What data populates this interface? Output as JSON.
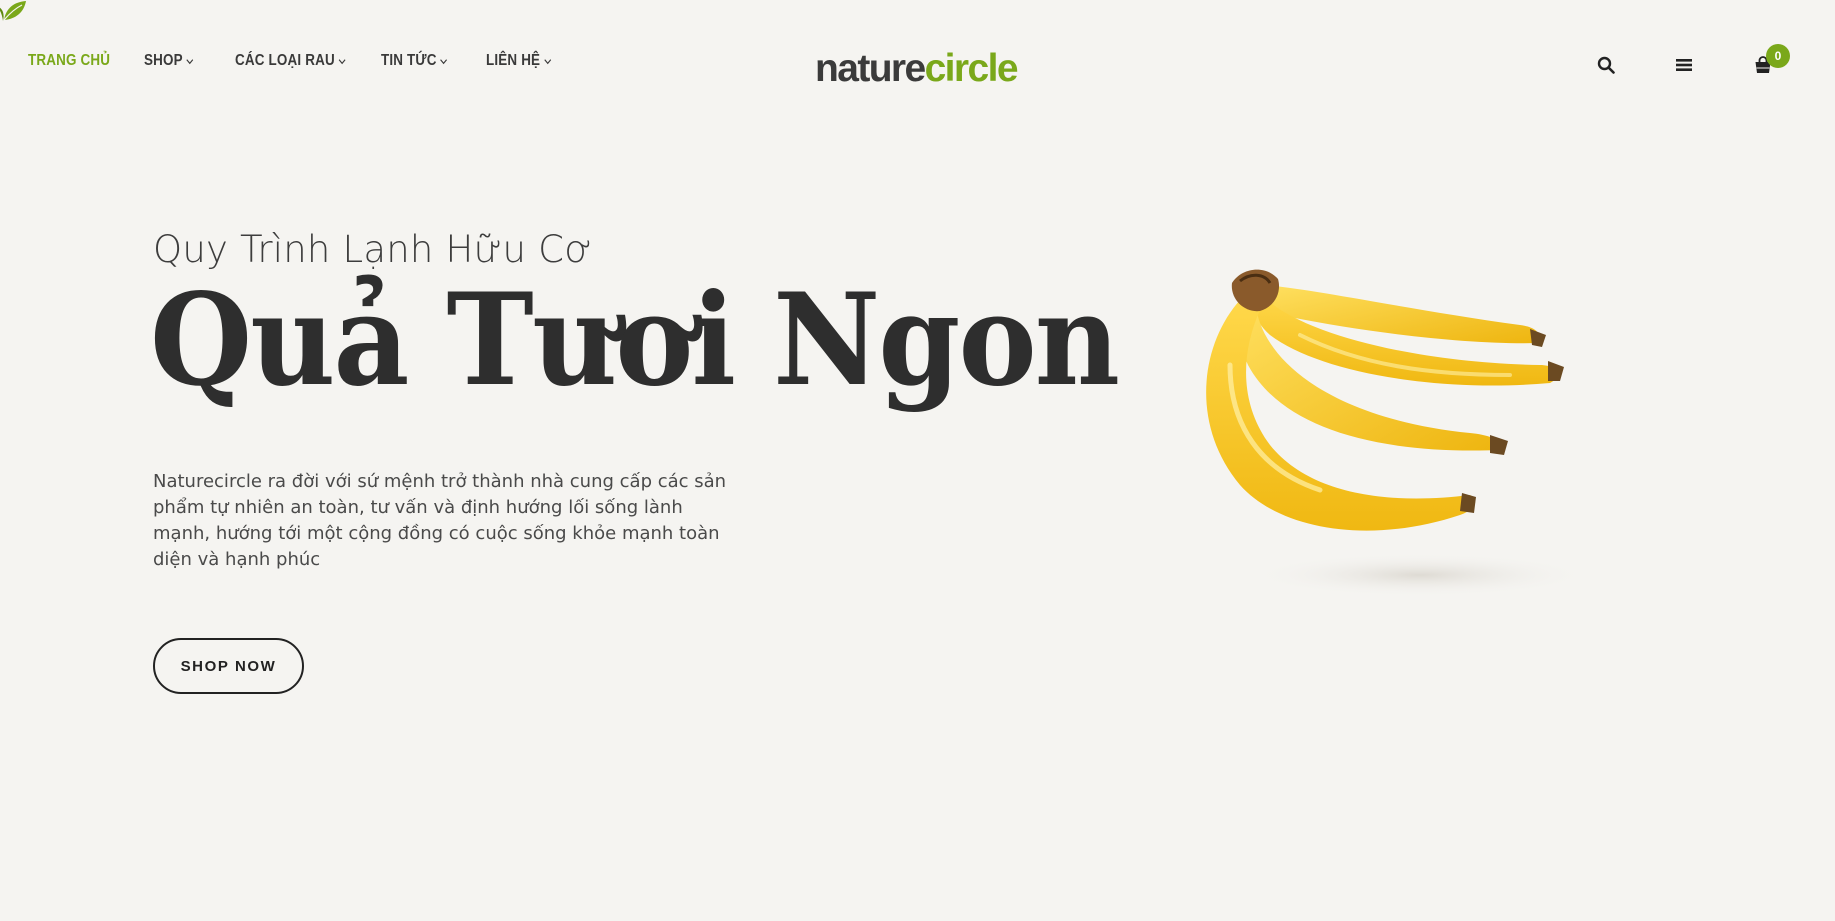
{
  "header": {
    "nav": [
      {
        "label": "TRANG CHỦ",
        "active": true,
        "has_dropdown": false
      },
      {
        "label": "SHOP",
        "active": false,
        "has_dropdown": true
      },
      {
        "label": "CÁC LOẠI RAU",
        "active": false,
        "has_dropdown": true
      },
      {
        "label": "TIN TỨC",
        "active": false,
        "has_dropdown": true
      },
      {
        "label": "LIÊN HỆ",
        "active": false,
        "has_dropdown": true
      }
    ],
    "logo": {
      "part1": "nature",
      "part2": "circle"
    },
    "icons": [
      "search-icon",
      "menu-icon",
      "cart-icon"
    ],
    "cart_count": "0"
  },
  "hero": {
    "subtitle": "Quy Trình Lạnh Hữu Cơ",
    "headline": "Quả Tươi Ngon",
    "description": "Naturecircle ra đời với sứ mệnh trở thành nhà cung cấp các sản phẩm tự nhiên an toàn, tư vấn và định hướng lối sống lành mạnh, hướng tới một cộng đồng có cuộc sống khỏe mạnh toàn diện và hạnh phúc",
    "cta_label": "SHOP NOW",
    "image": "banana-bunch"
  },
  "colors": {
    "background": "#f5f4f1",
    "accent": "#7aa81a",
    "text": "#2e2e2e"
  }
}
